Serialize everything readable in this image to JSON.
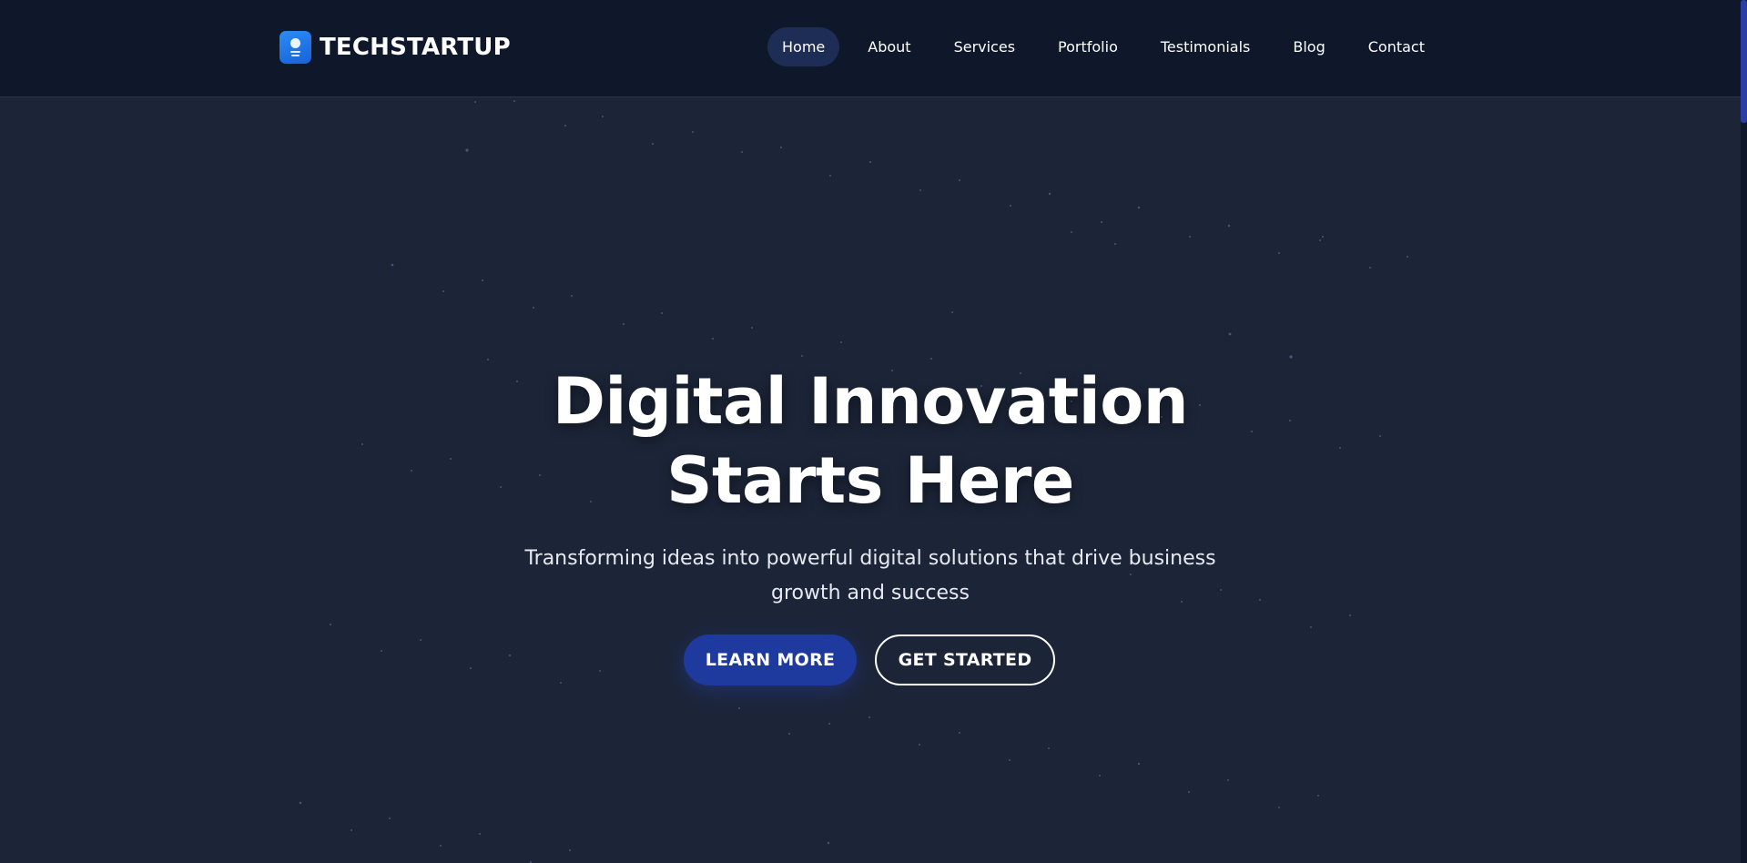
{
  "brand": {
    "name": "TECHSTARTUP",
    "icon": "lightbulb-icon",
    "accent_color": "#1f6fe8"
  },
  "nav": {
    "items": [
      {
        "label": "Home",
        "active": true
      },
      {
        "label": "About",
        "active": false
      },
      {
        "label": "Services",
        "active": false
      },
      {
        "label": "Portfolio",
        "active": false
      },
      {
        "label": "Testimonials",
        "active": false
      },
      {
        "label": "Blog",
        "active": false
      },
      {
        "label": "Contact",
        "active": false
      }
    ]
  },
  "hero": {
    "title_line1": "Digital Innovation",
    "title_line2": "Starts Here",
    "subtitle": "Transforming ideas into powerful digital solutions that drive business growth and success",
    "primary_button": "LEARN MORE",
    "secondary_button": "GET STARTED"
  },
  "colors": {
    "background": "#1c2538",
    "header_background": "#0f172b",
    "primary_button": "#1f3a9e",
    "nav_active": "#1e2d55"
  }
}
